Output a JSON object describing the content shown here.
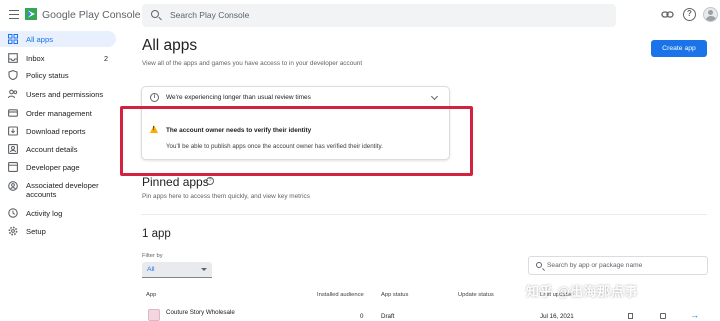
{
  "topbar": {
    "brand": "Google Play Console",
    "search_placeholder": "Search Play Console"
  },
  "sidebar": {
    "items": [
      {
        "label": "All apps",
        "icon": "grid-icon",
        "active": true
      },
      {
        "label": "Inbox",
        "icon": "inbox-icon",
        "count": "2"
      },
      {
        "label": "Policy status",
        "icon": "shield-icon"
      },
      {
        "label": "Users and permissions",
        "icon": "users-icon"
      },
      {
        "label": "Order management",
        "icon": "card-icon"
      },
      {
        "label": "Download reports",
        "icon": "download-icon"
      },
      {
        "label": "Account details",
        "icon": "account-icon"
      },
      {
        "label": "Developer page",
        "icon": "page-icon"
      },
      {
        "label": "Associated developer accounts",
        "icon": "linked-accounts-icon"
      },
      {
        "label": "Activity log",
        "icon": "history-icon"
      },
      {
        "label": "Setup",
        "icon": "gear-icon"
      }
    ]
  },
  "main": {
    "title": "All apps",
    "subtitle": "View all of the apps and games you have access to in your developer account",
    "create_button": "Create app",
    "review_notice": "We're experiencing longer than usual review times",
    "verify_title": "The account owner needs to verify their identity",
    "verify_body": "You'll be able to publish apps once the account owner has verified their identity.",
    "pinned_title": "Pinned apps",
    "pinned_subtitle": "Pin apps here to access them quickly, and view key metrics",
    "apps_count": "1 app",
    "filter_label": "Filter by",
    "filter_value": "All",
    "app_search_placeholder": "Search by app or package name"
  },
  "table": {
    "headers": {
      "app": "App",
      "installed": "Installed audience",
      "status": "App status",
      "update": "Update status",
      "last_updated": "Last updated"
    },
    "rows": [
      {
        "app": "Couture Story Wholesale",
        "installed": "0",
        "status": "Draft",
        "update": "",
        "last_updated": "Jul 16, 2021"
      }
    ]
  },
  "watermark": "知乎 @出海那点事",
  "colors": {
    "accent": "#1a73e8",
    "highlight_border": "#d3223f",
    "warning": "#f9ab00"
  }
}
